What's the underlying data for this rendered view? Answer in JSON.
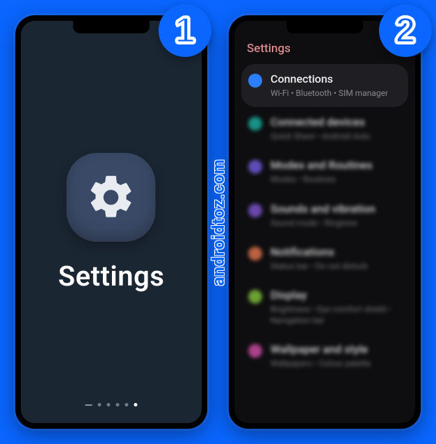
{
  "badges": {
    "step1": "1",
    "step2": "2"
  },
  "watermark": "androidtoz.com",
  "screen1": {
    "appName": "Settings",
    "iconName": "gear-icon"
  },
  "screen2": {
    "header": "Settings",
    "items": [
      {
        "title": "Connections",
        "subtitle": "Wi-Fi  •  Bluetooth  •  SIM manager",
        "iconColor": "#2b7fff",
        "focused": true
      },
      {
        "title": "Connected devices",
        "subtitle": "Quick Share  •  Android Auto",
        "iconColor": "#1aa89a",
        "focused": false
      },
      {
        "title": "Modes and Routines",
        "subtitle": "Modes  •  Routines",
        "iconColor": "#6a5ad7",
        "focused": false
      },
      {
        "title": "Sounds and vibration",
        "subtitle": "Sound mode  •  Ringtone",
        "iconColor": "#7a52c7",
        "focused": false
      },
      {
        "title": "Notifications",
        "subtitle": "Status bar  •  Do not disturb",
        "iconColor": "#d9704a",
        "focused": false
      },
      {
        "title": "Display",
        "subtitle": "Brightness  •  Eye comfort shield  •  Navigation bar",
        "iconColor": "#7dbb3a",
        "focused": false
      },
      {
        "title": "Wallpaper and style",
        "subtitle": "Wallpapers  •  Colour palette",
        "iconColor": "#c74aa0",
        "focused": false
      }
    ]
  }
}
